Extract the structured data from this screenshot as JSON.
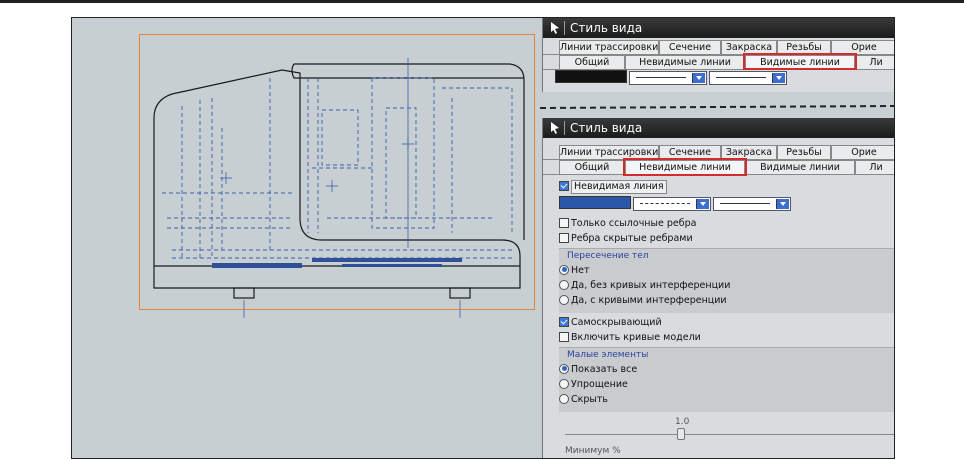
{
  "window": {
    "title": "Стиль вида"
  },
  "tabs_row1": [
    "Линии трассировки",
    "Сечение",
    "Закраска",
    "Резьбы",
    "Орие"
  ],
  "tabs_row2": [
    "Общий",
    "Невидимые линии",
    "Видимые линии",
    "Ли"
  ],
  "top_panel": {
    "active_tab": "Видимые линии"
  },
  "bottom_panel": {
    "active_tab": "Невидимые линии",
    "hidden_line": {
      "label": "Невидимая линия",
      "checked": true
    },
    "only_ref_edges": {
      "label": "Только ссылочные ребра",
      "checked": false
    },
    "edges_hidden_by_edges": {
      "label": "Ребра скрытые ребрами",
      "checked": false
    },
    "body_intersection": {
      "title": "Пересечение тел",
      "options": [
        "Нет",
        "Да, без кривых интерференции",
        "Да, с кривыми интерференции"
      ],
      "selected": "Нет"
    },
    "self_hiding": {
      "label": "Самоскрывающий",
      "checked": true
    },
    "include_model_curves": {
      "label": "Включить кривые модели",
      "checked": false
    },
    "small_features": {
      "title": "Малые элементы",
      "options": [
        "Показать все",
        "Упрощение",
        "Скрыть"
      ],
      "selected": "Показать все"
    },
    "slider": {
      "value_label": "1.0",
      "caption": "Минимум %"
    }
  },
  "colors": {
    "highlight": "#d42b2b",
    "accent": "#3a78d8",
    "visible_line_swatch": "#111111",
    "hidden_line_swatch": "#2a57a8",
    "selection_box": "#e8823a",
    "drawing_blue": "#3b5fa8"
  },
  "icons": {
    "title": "pointer-arrow-icon",
    "combo": "chevron-down-icon"
  }
}
